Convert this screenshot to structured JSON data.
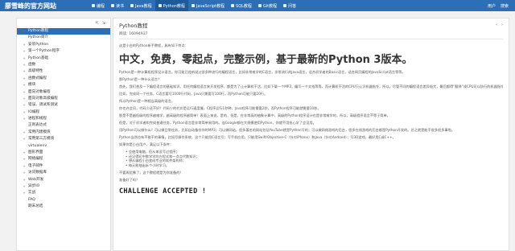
{
  "header": {
    "brand": "廖雪峰的官方网站",
    "nav": [
      {
        "label": "编程",
        "icon": "book-icon",
        "active": false
      },
      {
        "label": "读书",
        "icon": "reading-icon",
        "active": false
      },
      {
        "label": "Java教程",
        "icon": "java-icon",
        "active": false
      },
      {
        "label": "Python教程",
        "icon": "python-icon",
        "active": true
      },
      {
        "label": "JavaScript教程",
        "icon": "javascript-icon",
        "active": false
      },
      {
        "label": "SQL教程",
        "icon": "database-icon",
        "active": false
      },
      {
        "label": "Git教程",
        "icon": "git-icon",
        "active": false
      },
      {
        "label": "问答",
        "icon": "qa-icon",
        "active": false
      }
    ],
    "right": {
      "user": "用户",
      "search": "搜索"
    }
  },
  "sidebar": {
    "items": [
      {
        "label": "Python教程",
        "fold": "−",
        "active": true
      },
      {
        "label": "Python简介",
        "fold": ""
      },
      {
        "label": "安装Python",
        "fold": "+"
      },
      {
        "label": "第一个Python程序",
        "fold": "+"
      },
      {
        "label": "Python基础",
        "fold": "+"
      },
      {
        "label": "函数",
        "fold": "+"
      },
      {
        "label": "高级特性",
        "fold": "+"
      },
      {
        "label": "函数式编程",
        "fold": "+"
      },
      {
        "label": "模块",
        "fold": "+"
      },
      {
        "label": "面向对象编程",
        "fold": "+"
      },
      {
        "label": "面向对象高级编程",
        "fold": "+"
      },
      {
        "label": "错误、调试和测试",
        "fold": "+"
      },
      {
        "label": "IO编程",
        "fold": "+"
      },
      {
        "label": "进程和线程",
        "fold": "+"
      },
      {
        "label": "正则表达式",
        "fold": ""
      },
      {
        "label": "常用内建模块",
        "fold": "+"
      },
      {
        "label": "常用第三方模块",
        "fold": "+"
      },
      {
        "label": "virtualenv",
        "fold": ""
      },
      {
        "label": "图形界面",
        "fold": "+"
      },
      {
        "label": "网络编程",
        "fold": "+"
      },
      {
        "label": "电子邮件",
        "fold": "+"
      },
      {
        "label": "访问数据库",
        "fold": "+"
      },
      {
        "label": "Web开发",
        "fold": "+"
      },
      {
        "label": "异步IO",
        "fold": "+"
      },
      {
        "label": "实战",
        "fold": "+"
      },
      {
        "label": "FAQ",
        "fold": ""
      },
      {
        "label": "期末总结",
        "fold": ""
      }
    ]
  },
  "main": {
    "title": "Python教程",
    "reads": "阅读: 16094937",
    "intro": "这是小白的Python新手教程，具有如下特点：",
    "headline": "中文，免费，零起点，完整示例，基于最新的Python 3版本。",
    "paragraphs": [
      "Python是一种计算机程序设计语言。你可能已经听说过很多种流行的编程语言，比如非常难学的C语言，非常流行的Java语言，适合初学者的Basic语言，适合网页编程的JavaScript语言等等。",
      "那Python是一种什么语言？",
      "首先，我们普及一下编程语言的基础知识。用任何编程语言来开发程序，都是为了让计算机干活，比如下载一个MP3，编写一个文档等等，而计算机干活的CPU只认识机器指令，所以，尽管不同的编程语言差异极大，最后都得“翻译”成CPU可以执行的机器指令。而不同的编程语言，干同一个活，编写的代码量，差距也很大。",
      "比如，完成同一个任务，C语言要写1000行代码，Java只需要写100行，而Python可能只要20行。",
      "所以Python是一种相当高级的语言。",
      "你也许会问，代码少还不好？代码少的代价是运行速度慢，C程序运行1秒钟，Java程序可能需要2秒，而Python程序可能就需要10秒。",
      "那是不是越低级的程序越难学，越高级的程序越简单？表面上来说，是的，但是，在非常高的抽象计算中，高级的Python程序设计也是非常难学的，所以，高级程序语言不等于简单。",
      "但是，对于初学者和完成普通任务，Python语言是非常简单易用的。连Google都在大规模使用Python，你就不用担心学了会没用。",
      "用Python可以做什么？可以做日常任务，比如自动备份你的MP3；可以做网站，很多著名的网站包括YouTube就是Python写的；可以做网络游戏的后台，很多在线游戏的后台都是Python开发的。总之就是能干很多很多事啦。",
      "Python当然也有不能干的事情，比如写操作系统，这个只能用C语言写；写手机应用，只能用Swift/Objective-C（针对iPhone）和Java（针对Android）；写3D游戏，最好用C或C++。",
      "如果你是小白用户，满足以下条件："
    ],
    "bullets": [
      "会使用电脑，但从来没写过程序；",
      "还记得初中数学学的方程式和一点点代数知识；",
      "想从编程小白变成专业的软件架构师；",
      "每天能抽出半个小时学习。"
    ],
    "outro1": "不要再犹豫了，这个教程就是为你准备的！",
    "outro2": "准备好了吗？",
    "challenge": "CHALLENGE ACCEPTED !"
  }
}
